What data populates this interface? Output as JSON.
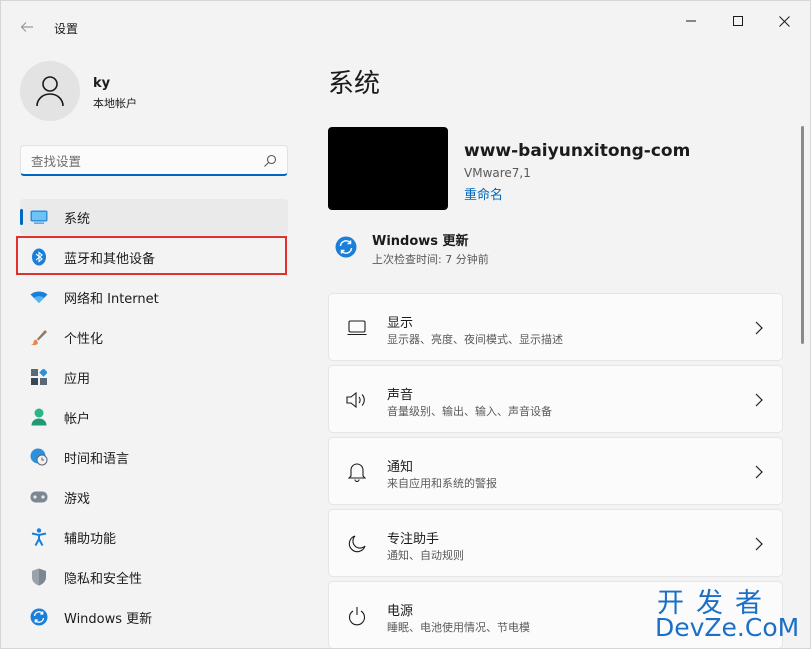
{
  "window": {
    "title": "设置",
    "back_icon": "back-arrow-icon",
    "controls": [
      "minimize-icon",
      "maximize-icon",
      "close-icon"
    ]
  },
  "user": {
    "name": "ky",
    "account_type": "本地帐户"
  },
  "search": {
    "placeholder": "查找设置",
    "value": ""
  },
  "sidebar": {
    "items": [
      {
        "label": "系统",
        "icon": "monitor-icon",
        "active": true
      },
      {
        "label": "蓝牙和其他设备",
        "icon": "bluetooth-icon",
        "active": false
      },
      {
        "label": "网络和 Internet",
        "icon": "wifi-icon",
        "active": false
      },
      {
        "label": "个性化",
        "icon": "brush-icon",
        "active": false
      },
      {
        "label": "应用",
        "icon": "apps-icon",
        "active": false
      },
      {
        "label": "帐户",
        "icon": "person-icon",
        "active": false
      },
      {
        "label": "时间和语言",
        "icon": "globe-clock-icon",
        "active": false
      },
      {
        "label": "游戏",
        "icon": "gamepad-icon",
        "active": false
      },
      {
        "label": "辅助功能",
        "icon": "accessibility-icon",
        "active": false
      },
      {
        "label": "隐私和安全性",
        "icon": "shield-icon",
        "active": false
      },
      {
        "label": "Windows 更新",
        "icon": "windows-update-icon",
        "active": false
      }
    ]
  },
  "main": {
    "title": "系统",
    "device": {
      "name": "www-baiyunxitong-com",
      "model": "VMware7,1",
      "rename": "重命名"
    },
    "update": {
      "title": "Windows 更新",
      "subtitle": "上次检查时间: 7 分钟前"
    },
    "cards": [
      {
        "title": "显示",
        "subtitle": "显示器、亮度、夜间模式、显示描述",
        "icon": "display-icon"
      },
      {
        "title": "声音",
        "subtitle": "音量级别、输出、输入、声音设备",
        "icon": "speaker-icon"
      },
      {
        "title": "通知",
        "subtitle": "来自应用和系统的警报",
        "icon": "bell-icon"
      },
      {
        "title": "专注助手",
        "subtitle": "通知、自动规则",
        "icon": "moon-icon"
      },
      {
        "title": "电源",
        "subtitle": "睡眠、电池使用情况、节电模",
        "icon": "power-icon"
      }
    ]
  },
  "watermark": {
    "line1": "开发者",
    "line2": "DevZe.CoM"
  },
  "colors": {
    "accent": "#0067c0",
    "highlight": "#e0312f",
    "watermark": "#1c6fc9"
  }
}
